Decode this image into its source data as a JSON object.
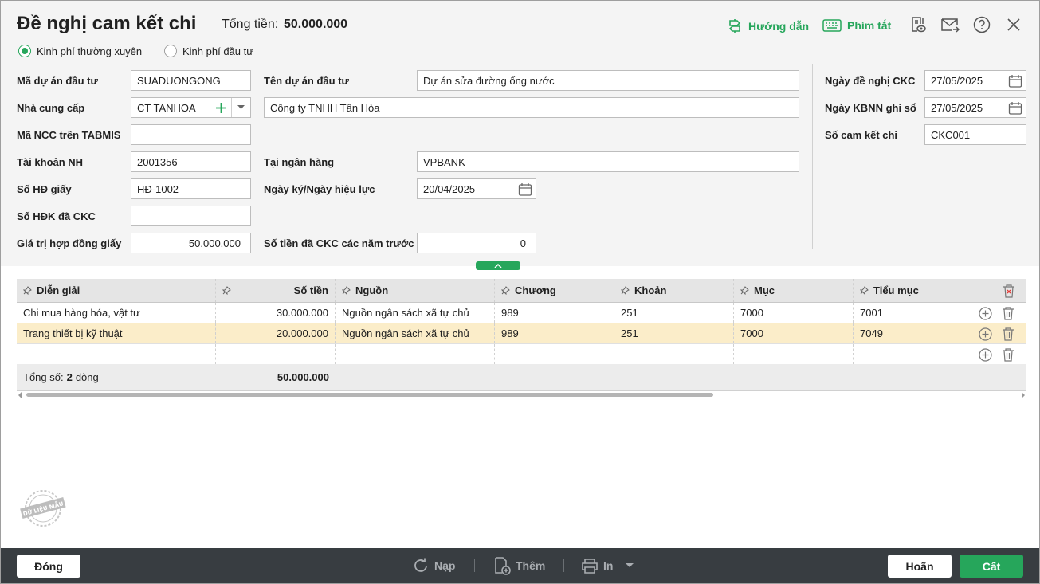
{
  "header": {
    "title": "Đề nghị cam kết chi",
    "total_label": "Tổng tiền:",
    "total_value": "50.000.000",
    "guide_label": "Hướng dẫn",
    "shortcut_label": "Phím tắt"
  },
  "funding": {
    "options": [
      "Kinh phí thường xuyên",
      "Kinh phí đầu tư"
    ],
    "selected": "Kinh phí thường xuyên"
  },
  "form": {
    "project_code_label": "Mã dự án đầu tư",
    "project_code": "SUADUONGONG",
    "project_name_label": "Tên dự án đầu tư",
    "project_name": "Dự án sửa đường ống nước",
    "supplier_label": "Nhà cung cấp",
    "supplier_code": "CT TANHOA",
    "supplier_name": "Công ty TNHH Tân Hòa",
    "tabmis_label": "Mã NCC trên TABMIS",
    "tabmis_value": "",
    "bank_account_label": "Tài khoản NH",
    "bank_account": "2001356",
    "bank_label": "Tại ngân hàng",
    "bank": "VPBANK",
    "contract_no_label": "Số HĐ giấy",
    "contract_no": "HĐ-1002",
    "sign_date_label": "Ngày ký/Ngày hiệu lực",
    "sign_date": "20/04/2025",
    "hdk_label": "Số HĐK đã CKC",
    "hdk_value": "",
    "contract_value_label": "Giá trị hợp đồng giấy",
    "contract_value": "50.000.000",
    "prev_ckc_label": "Số tiền đã CKC các năm trước",
    "prev_ckc": "0",
    "request_date_label": "Ngày đề nghị CKC",
    "request_date": "27/05/2025",
    "kbnn_date_label": "Ngày KBNN ghi sổ",
    "kbnn_date": "27/05/2025",
    "commit_no_label": "Số cam kết chi",
    "commit_no": "CKC001"
  },
  "grid": {
    "columns": [
      "Diễn giải",
      "Số tiền",
      "Nguồn",
      "Chương",
      "Khoản",
      "Mục",
      "Tiểu mục"
    ],
    "rows": [
      {
        "desc": "Chi mua hàng hóa, vật tư",
        "amount": "30.000.000",
        "source": "Nguồn ngân sách xã tự chủ",
        "chapter": "989",
        "item": "251",
        "section": "7000",
        "subsection": "7001"
      },
      {
        "desc": "Trang thiết bị kỹ thuật",
        "amount": "20.000.000",
        "source": "Nguồn ngân sách xã tự chủ",
        "chapter": "989",
        "item": "251",
        "section": "7000",
        "subsection": "7049"
      }
    ],
    "footer_label": "Tổng số:",
    "footer_count": "2",
    "footer_unit": "dòng",
    "footer_total": "50.000.000",
    "selected_row_color": "#fbedc9"
  },
  "watermark": "DỮ LIỆU MẪU",
  "footer": {
    "close": "Đóng",
    "reload": "Nạp",
    "add": "Thêm",
    "print": "In",
    "cancel": "Hoãn",
    "save": "Cất"
  },
  "colors": {
    "accent": "#26a65b",
    "footer_bg": "#383d41"
  }
}
